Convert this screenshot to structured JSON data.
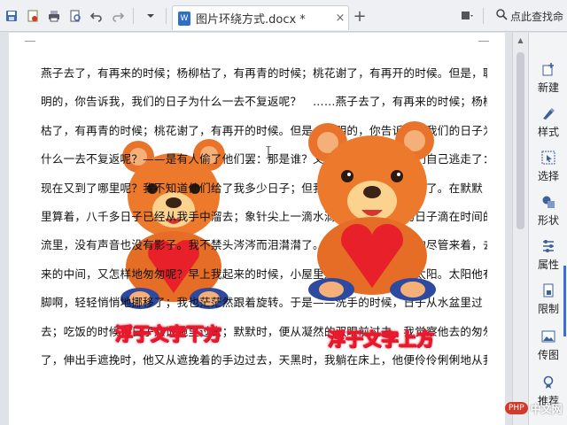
{
  "toolbar": {
    "icons": [
      "save-icon",
      "export-pdf-icon",
      "print-icon",
      "print-preview-icon",
      "undo-icon",
      "redo-icon",
      "dropdown-icon"
    ],
    "app_logo": "W"
  },
  "tab": {
    "doc_badge": "W",
    "title": "图片环绕方式.docx *",
    "close": "×",
    "new_tab": "+"
  },
  "search": {
    "label": "点此查找命"
  },
  "document": {
    "lines": [
      "燕子去了，有再来的时候；杨柳枯了，有再青的时候；桃花谢了，有再开的时候。但是，聪",
      "明的，你告诉我，我们的日子为什么一去不复返呢？　……燕子去了，有再来的时候；杨柳",
      "枯了，有再青的时候；桃花谢了，有再开的时候。但是，聪明的，你告诉我，我们的日子为",
      "什么一去不复返呢？——是有人偷了他们罢：那是谁？又藏在何处呢？是他们自己逃走了：",
      "现在又到了哪里呢？我不知道他们给了我多少日子；但我的手确乎是渐渐空虚了。在默默",
      "里算着，八千多日子已经从我手中溜去；象针尖上一滴水滴在大海里，我的日子滴在时间的",
      "流里，没有声音也没有影子。我不禁头涔涔而泪潸潸了。去的尽管去了，来的尽管来着，去",
      "来的中间，又怎样地匆匆呢？早上我起来的时候，小屋里射进两三方斜斜的太阳。太阳他有",
      "脚啊，轻轻悄悄地挪移了；我也茫茫然跟着旋转。于是——洗手的时候，日子从水盆里过",
      "去；吃饭的时候，日子从饭碗里过去；默默时，便从凝然的双眼前过去。我觉察他去的匆匆",
      "了，伸出手遮挽时，他又从遮挽着的手边过去，天黑时，我躺在床上，他便伶伶俐俐地从我"
    ]
  },
  "captions": {
    "behind": "浮于文字下方",
    "front": "浮于文字上方"
  },
  "panel": {
    "items": [
      {
        "icon": "new-doc-icon",
        "label": "新建"
      },
      {
        "icon": "style-icon",
        "label": "样式"
      },
      {
        "icon": "select-icon",
        "label": "选择"
      },
      {
        "icon": "shape-icon",
        "label": "形状"
      },
      {
        "icon": "properties-icon",
        "label": "属性"
      },
      {
        "icon": "restrict-icon",
        "label": "限制"
      },
      {
        "icon": "image-icon",
        "label": "传图"
      },
      {
        "icon": "recommend-icon",
        "label": "推荐"
      }
    ]
  },
  "watermark": {
    "badge": "PHP",
    "text": "中文网"
  },
  "colors": {
    "accent": "#3a6ed6",
    "caption_outline": "#e8192c",
    "bear_fur": "#e9732a",
    "heart": "#e8202a"
  }
}
